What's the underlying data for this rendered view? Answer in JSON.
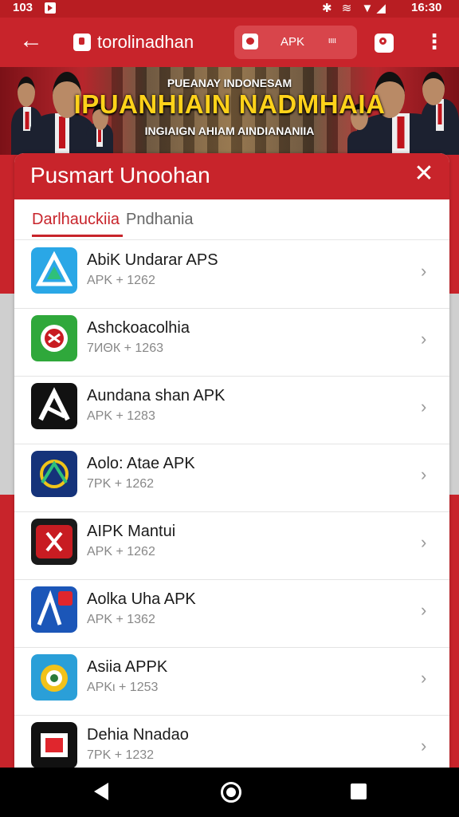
{
  "status_bar": {
    "time_left": "103",
    "time_right": "16:30",
    "icons": "✱ ≋ ▼◢"
  },
  "app_bar": {
    "back": "←",
    "site_title": "torolinadhan",
    "chip_label": "APK",
    "chip_dots": "ιιιι",
    "menu": "⋮"
  },
  "banner": {
    "line1": "PUEANAY INDONESAM",
    "line2": "IPUANHIAIN NADMHAIA",
    "line3": "INGIAIGN AHIAM AINDIANANIIA"
  },
  "sheet": {
    "title": "Pusmart Unoohan",
    "close": "✕",
    "tabs": [
      {
        "label": "Darlhauckiia"
      },
      {
        "label": "Pndhania"
      }
    ]
  },
  "apps": [
    {
      "name": "AbiK Undarar APS",
      "meta": "APK + 1262",
      "icon": "triangle-logo-icon",
      "color": "#2aa7e6"
    },
    {
      "name": "Ashckoacolhia",
      "meta": "7ИΘК + 1263",
      "icon": "crest-logo-icon",
      "color": "#2fa83b"
    },
    {
      "name": "Aundana shan APK",
      "meta": "APK + 1283",
      "icon": "a-mark-logo-icon",
      "color": "#111111"
    },
    {
      "name": "Aolo: Atae APK",
      "meta": "7PK + 1262",
      "icon": "garuda-logo-icon",
      "color": "#15337a"
    },
    {
      "name": "AIPK Mantui",
      "meta": "APK + 1262",
      "icon": "shield-logo-icon",
      "color": "#c81c22"
    },
    {
      "name": "Aolka Uha APK",
      "meta": "APK + 1362",
      "icon": "ar-logo-icon",
      "color": "#1b56b8"
    },
    {
      "name": "Asiia APPK",
      "meta": "APKι + 1253",
      "icon": "emblem-logo-icon",
      "color": "#2a9fd8"
    },
    {
      "name": "Dehia Nnadao",
      "meta": "7PK + 1232",
      "icon": "box-logo-icon",
      "color": "#111111"
    }
  ],
  "row_chevron": "›"
}
